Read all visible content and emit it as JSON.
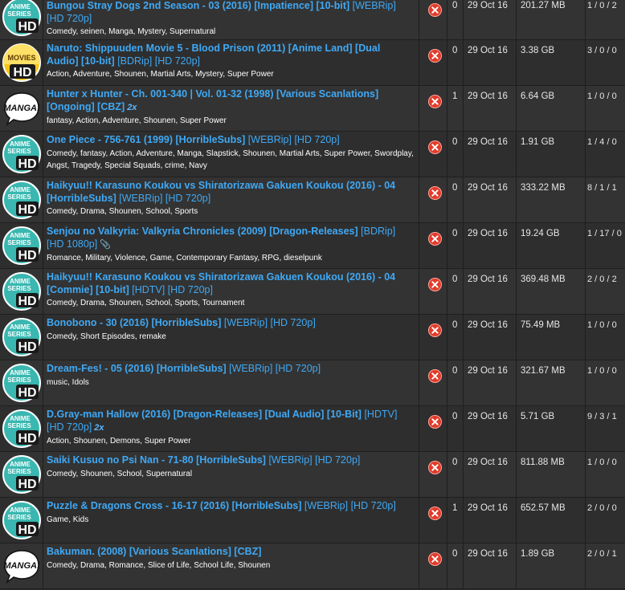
{
  "colors": {
    "link": "#3fa9f5",
    "delete": "#e23b2a",
    "row_odd": "#333333",
    "row_even": "#2e2e2e"
  },
  "rows": [
    {
      "category": "anime-series-hd",
      "category_text": [
        "ANIME",
        "SERIES",
        "HD"
      ],
      "title_bold": "Bungou Stray Dogs 2nd Season - 03 (2016) [Impatience] [10-bit]",
      "title_light": " [WEBRip] [HD 720p]",
      "badge": "",
      "tags": "Comedy, seinen, Manga, Mystery, Supernatural",
      "comments": "0",
      "date": "29 Oct 16",
      "size": "201.27 MB",
      "stats": "1 / 0 / 2"
    },
    {
      "category": "movies-hd",
      "category_text": [
        "MOVIES",
        "HD"
      ],
      "title_bold": "Naruto: Shippuuden Movie 5 - Blood Prison (2011) [Anime Land] [Dual Audio] [10-bit]",
      "title_light": " [BDRip] [HD 720p]",
      "badge": "",
      "tags": "Action, Adventure, Shounen, Martial Arts, Mystery, Super Power",
      "comments": "0",
      "date": "29 Oct 16",
      "size": "3.38 GB",
      "stats": "3 / 0 / 0"
    },
    {
      "category": "manga",
      "category_text": [
        "MANGA!"
      ],
      "title_bold": "Hunter x Hunter - Ch. 001-340 | Vol. 01-32 (1998) [Various Scanlations] [Ongoing] [CBZ]",
      "title_light": "",
      "badge": "2x",
      "tags": "fantasy, Action, Adventure, Shounen, Super Power",
      "comments": "1",
      "date": "29 Oct 16",
      "size": "6.64 GB",
      "stats": "1 / 0 / 0"
    },
    {
      "category": "anime-series-hd",
      "category_text": [
        "ANIME",
        "SERIES",
        "HD"
      ],
      "title_bold": "One Piece - 756-761 (1999) [HorribleSubs]",
      "title_light": " [WEBRip] [HD 720p]",
      "badge": "",
      "tags": "Comedy, fantasy, Action, Adventure, Manga, Slapstick, Shounen, Martial Arts, Super Power, Swordplay, Angst, Tragedy, Special Squads, crime, Navy",
      "comments": "0",
      "date": "29 Oct 16",
      "size": "1.91 GB",
      "stats": "1 / 4 / 0"
    },
    {
      "category": "anime-series-hd",
      "category_text": [
        "ANIME",
        "SERIES",
        "HD"
      ],
      "title_bold": "Haikyuu!! Karasuno Koukou vs Shiratorizawa Gakuen Koukou (2016) - 04 [HorribleSubs]",
      "title_light": " [WEBRip] [HD 720p]",
      "badge": "",
      "tags": "Comedy, Drama, Shounen, School, Sports",
      "comments": "0",
      "date": "29 Oct 16",
      "size": "333.22 MB",
      "stats": "8 / 1 / 1"
    },
    {
      "category": "anime-series-hd",
      "category_text": [
        "ANIME",
        "SERIES",
        "HD"
      ],
      "title_bold": "Senjou no Valkyria: Valkyria Chronicles (2009) [Dragon-Releases]",
      "title_light": " [BDRip] [HD 1080p]",
      "badge": "",
      "clip": true,
      "tags": "Romance, Military, Violence, Game, Contemporary Fantasy, RPG, dieselpunk",
      "comments": "0",
      "date": "29 Oct 16",
      "size": "19.24 GB",
      "stats": "1 / 17 / 0"
    },
    {
      "category": "anime-series-hd",
      "category_text": [
        "ANIME",
        "SERIES",
        "HD"
      ],
      "title_bold": "Haikyuu!! Karasuno Koukou vs Shiratorizawa Gakuen Koukou (2016) - 04 [Commie] [10-bit]",
      "title_light": " [HDTV] [HD 720p]",
      "badge": "",
      "tags": "Comedy, Drama, Shounen, School, Sports, Tournament",
      "comments": "0",
      "date": "29 Oct 16",
      "size": "369.48 MB",
      "stats": "2 / 0 / 2"
    },
    {
      "category": "anime-series-hd",
      "category_text": [
        "ANIME",
        "SERIES",
        "HD"
      ],
      "title_bold": "Bonobono - 30 (2016) [HorribleSubs]",
      "title_light": " [WEBRip] [HD 720p]",
      "badge": "",
      "tags": "Comedy, Short Episodes, remake",
      "comments": "0",
      "date": "29 Oct 16",
      "size": "75.49 MB",
      "stats": "1 / 0 / 0"
    },
    {
      "category": "anime-series-hd",
      "category_text": [
        "ANIME",
        "SERIES",
        "HD"
      ],
      "title_bold": "Dream-Fes! - 05 (2016) [HorribleSubs]",
      "title_light": " [WEBRip] [HD 720p]",
      "badge": "",
      "tags": "music, Idols",
      "comments": "0",
      "date": "29 Oct 16",
      "size": "321.67 MB",
      "stats": "1 / 0 / 0"
    },
    {
      "category": "anime-series-hd",
      "category_text": [
        "ANIME",
        "SERIES",
        "HD"
      ],
      "title_bold": "D.Gray-man Hallow (2016) [Dragon-Releases] [Dual Audio] [10-Bit]",
      "title_light": " [HDTV] [HD 720p]",
      "badge": "2x",
      "tags": "Action, Shounen, Demons, Super Power",
      "comments": "0",
      "date": "29 Oct 16",
      "size": "5.71 GB",
      "stats": "9 / 3 / 1"
    },
    {
      "category": "anime-series-hd",
      "category_text": [
        "ANIME",
        "SERIES",
        "HD"
      ],
      "title_bold": "Saiki Kusuo no Psi Nan - 71-80 [HorribleSubs]",
      "title_light": " [WEBRip] [HD 720p]",
      "badge": "",
      "tags": "Comedy, Shounen, School, Supernatural",
      "comments": "0",
      "date": "29 Oct 16",
      "size": "811.88 MB",
      "stats": "1 / 0 / 0"
    },
    {
      "category": "anime-series-hd",
      "category_text": [
        "ANIME",
        "SERIES",
        "HD"
      ],
      "title_bold": "Puzzle & Dragons Cross - 16-17 (2016) [HorribleSubs]",
      "title_light": " [WEBRip] [HD 720p]",
      "badge": "",
      "tags": "Game, Kids",
      "comments": "1",
      "date": "29 Oct 16",
      "size": "652.57 MB",
      "stats": "2 / 0 / 0"
    },
    {
      "category": "manga",
      "category_text": [
        "MANGA!"
      ],
      "title_bold": "Bakuman. (2008) [Various Scanlations] [CBZ]",
      "title_light": "",
      "badge": "",
      "tags": "Comedy, Drama, Romance, Slice of Life, School Life, Shounen",
      "comments": "0",
      "date": "29 Oct 16",
      "size": "1.89 GB",
      "stats": "2 / 0 / 1"
    }
  ]
}
